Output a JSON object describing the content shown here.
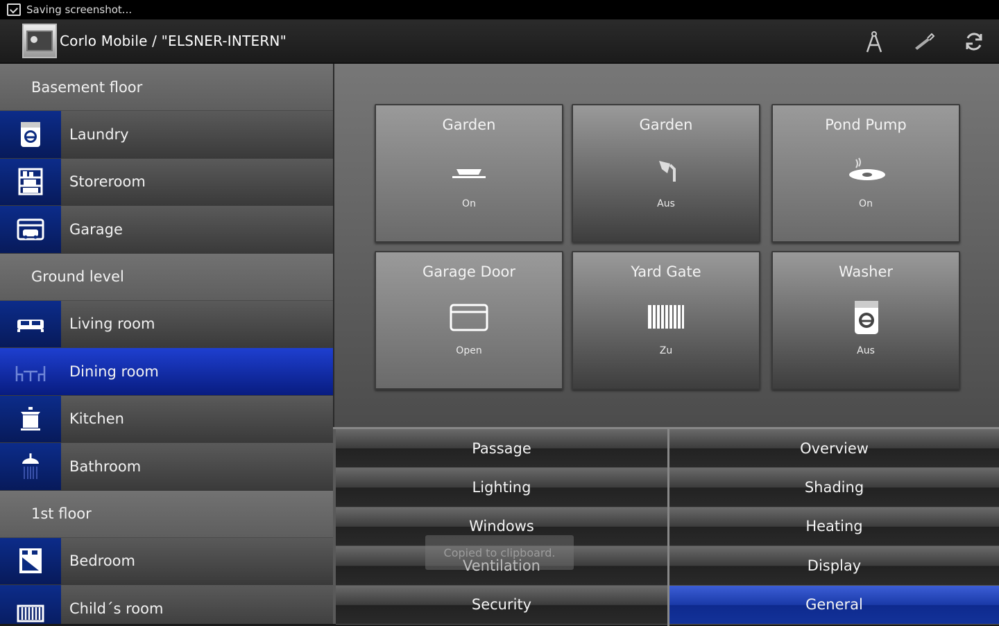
{
  "status_bar": {
    "notification": "Saving screenshot..."
  },
  "action_bar": {
    "title": "Corlo Mobile / \"ELSNER-INTERN\"",
    "actions": [
      {
        "name": "compass-icon"
      },
      {
        "name": "tool-icon"
      },
      {
        "name": "refresh-icon"
      }
    ]
  },
  "sidebar": {
    "sections": [
      {
        "title": "Basement floor",
        "rooms": [
          "Laundry",
          "Storeroom",
          "Garage"
        ]
      },
      {
        "title": "Ground level",
        "rooms": [
          "Living room",
          "Dining room",
          "Kitchen",
          "Bathroom"
        ]
      },
      {
        "title": "1st floor",
        "rooms": [
          "Bedroom",
          "Child´s room"
        ]
      }
    ],
    "active_room": "Dining room"
  },
  "tiles": [
    {
      "title": "Garden",
      "icon": "lamp-icon",
      "state": "On"
    },
    {
      "title": "Garden",
      "icon": "sprinkler-icon",
      "state": "Aus"
    },
    {
      "title": "Pond Pump",
      "icon": "pond-pump-icon",
      "state": "On"
    },
    {
      "title": "Garage Door",
      "icon": "garage-door-icon",
      "state": "Open"
    },
    {
      "title": "Yard Gate",
      "icon": "gate-icon",
      "state": "Zu"
    },
    {
      "title": "Washer",
      "icon": "washer-icon",
      "state": "Aus"
    }
  ],
  "menu": {
    "left": [
      "Passage",
      "Lighting",
      "Windows",
      "Ventilation",
      "Security"
    ],
    "right": [
      "Overview",
      "Shading",
      "Heating",
      "Display",
      "General"
    ],
    "active": "General"
  },
  "toast": "Copied to clipboard."
}
